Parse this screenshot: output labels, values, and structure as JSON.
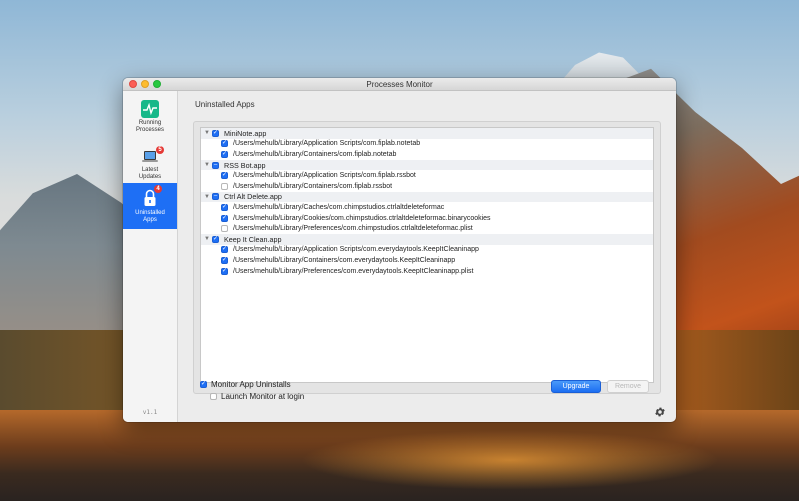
{
  "window": {
    "title": "Processes Monitor"
  },
  "sidebar": {
    "items": [
      {
        "label_line1": "Running",
        "label_line2": "Processes",
        "badge": ""
      },
      {
        "label_line1": "Latest",
        "label_line2": "Updates",
        "badge": "5"
      },
      {
        "label_line1": "Uninstalled",
        "label_line2": "Apps",
        "badge": "4"
      }
    ],
    "version": "v1.1"
  },
  "main": {
    "section_title": "Uninstalled Apps",
    "groups": [
      {
        "name": "MiniNote.app",
        "state": "checked",
        "files": [
          {
            "path": "/Users/mehulb/Library/Application Scripts/com.fiplab.notetab",
            "checked": true
          },
          {
            "path": "/Users/mehulb/Library/Containers/com.fiplab.notetab",
            "checked": true
          }
        ]
      },
      {
        "name": "RSS Bot.app",
        "state": "mixed",
        "files": [
          {
            "path": "/Users/mehulb/Library/Application Scripts/com.fiplab.rssbot",
            "checked": true
          },
          {
            "path": "/Users/mehulb/Library/Containers/com.fiplab.rssbot",
            "checked": false
          }
        ]
      },
      {
        "name": "Ctrl Alt Delete.app",
        "state": "mixed",
        "files": [
          {
            "path": "/Users/mehulb/Library/Caches/com.chimpstudios.ctrlaltdeleteformac",
            "checked": true
          },
          {
            "path": "/Users/mehulb/Library/Cookies/com.chimpstudios.ctrlaltdeleteformac.binarycookies",
            "checked": true
          },
          {
            "path": "/Users/mehulb/Library/Preferences/com.chimpstudios.ctrlaltdeleteformac.plist",
            "checked": false
          }
        ]
      },
      {
        "name": "Keep It Clean.app",
        "state": "checked",
        "files": [
          {
            "path": "/Users/mehulb/Library/Application Scripts/com.everydaytools.KeepItCleaninapp",
            "checked": true
          },
          {
            "path": "/Users/mehulb/Library/Containers/com.everydaytools.KeepItCleaninapp",
            "checked": true
          },
          {
            "path": "/Users/mehulb/Library/Preferences/com.everydaytools.KeepItCleaninapp.plist",
            "checked": true
          }
        ]
      }
    ]
  },
  "footer": {
    "monitor_label": "Monitor App Uninstalls",
    "monitor_checked": true,
    "launch_label": "Launch Monitor at login",
    "launch_checked": false,
    "upgrade_label": "Upgrade",
    "remove_label": "Remove"
  },
  "colors": {
    "accent": "#1e6ff5",
    "badge": "#e53935",
    "running_icon": "#17b889"
  },
  "icons": [
    "pulse-icon",
    "laptop-icon",
    "lock-icon",
    "gear-icon",
    "disclosure-triangle-icon"
  ]
}
